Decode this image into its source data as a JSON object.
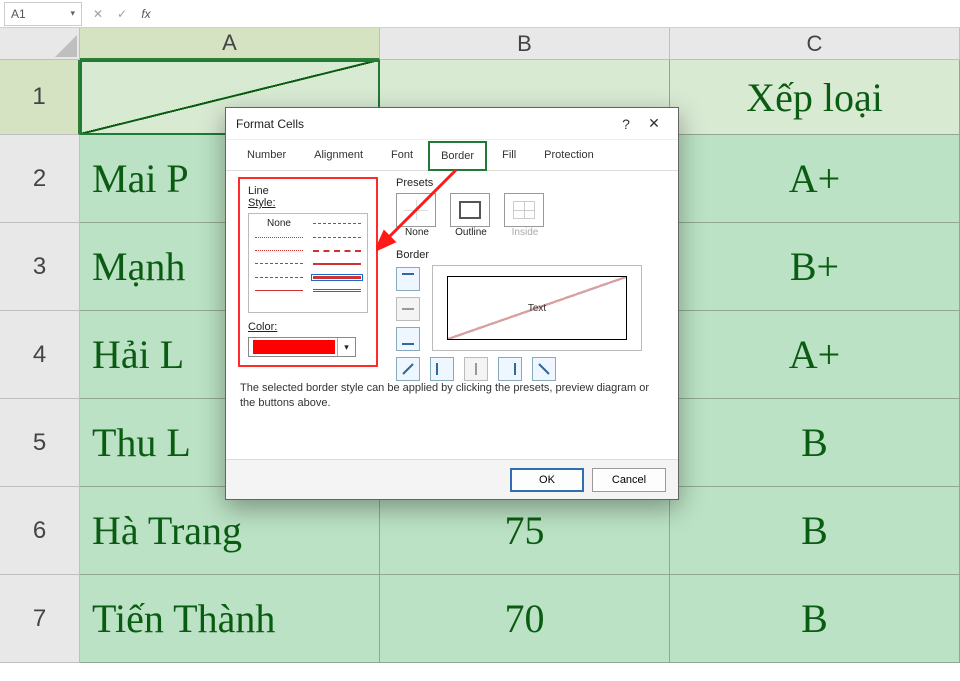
{
  "formula_bar": {
    "cell_ref": "A1",
    "fx_label": "fx"
  },
  "columns": [
    "A",
    "B",
    "C"
  ],
  "row_numbers": [
    "1",
    "2",
    "3",
    "4",
    "5",
    "6",
    "7"
  ],
  "grid": {
    "header_row": {
      "A": "",
      "B": "",
      "C": "Xếp loại"
    },
    "rows": [
      {
        "A": "Mai P",
        "B": "",
        "C": "A+"
      },
      {
        "A": "Mạnh",
        "B": "",
        "C": "B+"
      },
      {
        "A": "Hải L",
        "B": "",
        "C": "A+"
      },
      {
        "A": "Thu L",
        "B": "",
        "C": "B"
      },
      {
        "A": "Hà Trang",
        "B": "75",
        "C": "B"
      },
      {
        "A": "Tiến Thành",
        "B": "70",
        "C": "B"
      }
    ]
  },
  "dialog": {
    "title": "Format Cells",
    "tabs": [
      "Number",
      "Alignment",
      "Font",
      "Border",
      "Fill",
      "Protection"
    ],
    "active_tab": "Border",
    "line_label": "Line",
    "style_label": "Style:",
    "none_option": "None",
    "color_label": "Color:",
    "selected_color": "#ff0000",
    "presets_label": "Presets",
    "preset_none": "None",
    "preset_outline": "Outline",
    "preset_inside": "Inside",
    "border_label": "Border",
    "preview_text": "Text",
    "hint": "The selected border style can be applied by clicking the presets, preview diagram or the buttons above.",
    "ok": "OK",
    "cancel": "Cancel"
  }
}
